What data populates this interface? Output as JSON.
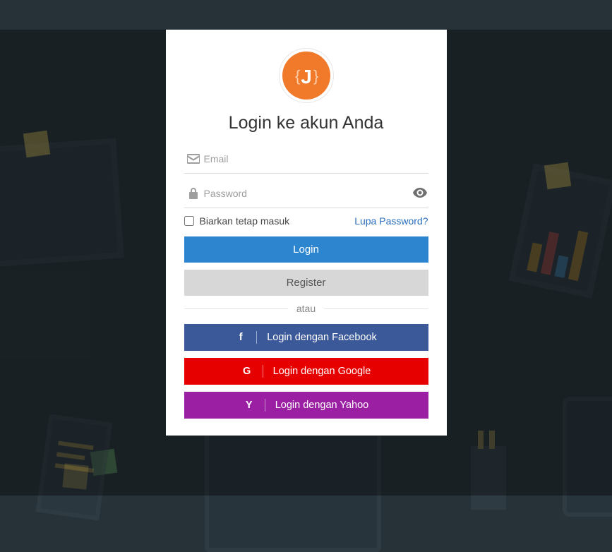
{
  "title": "Login ke akun Anda",
  "logo_text": "J",
  "brand_color": "#f1792a",
  "fields": {
    "email": {
      "placeholder": "Email",
      "value": ""
    },
    "password": {
      "placeholder": "Password",
      "value": ""
    }
  },
  "remember": {
    "label": "Biarkan tetap masuk",
    "checked": false
  },
  "forgot_label": "Lupa Password?",
  "buttons": {
    "login": "Login",
    "register": "Register"
  },
  "divider_label": "atau",
  "social": {
    "facebook": {
      "label": "Login dengan Facebook",
      "icon": "f"
    },
    "google": {
      "label": "Login dengan Google",
      "icon": "G"
    },
    "yahoo": {
      "label": "Login dengan Yahoo",
      "icon": "Y"
    }
  }
}
